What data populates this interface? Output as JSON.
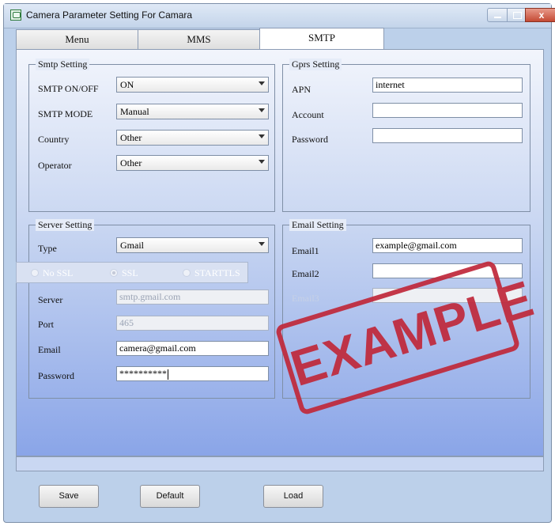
{
  "window": {
    "title": "Camera Parameter Setting For  Camara",
    "close_label": "x"
  },
  "tabs": [
    {
      "label": "Menu"
    },
    {
      "label": "MMS"
    },
    {
      "label": "SMTP"
    }
  ],
  "smtp_setting": {
    "title": "Smtp Setting",
    "rows": [
      {
        "label": "SMTP ON/OFF",
        "value": "ON"
      },
      {
        "label": "SMTP MODE",
        "value": "Manual"
      },
      {
        "label": "Country",
        "value": "Other"
      },
      {
        "label": "Operator",
        "value": "Other"
      }
    ]
  },
  "gprs_setting": {
    "title": "Gprs Setting",
    "rows": [
      {
        "label": "APN",
        "value": "internet"
      },
      {
        "label": "Account",
        "value": ""
      },
      {
        "label": "Password",
        "value": ""
      }
    ]
  },
  "server_setting": {
    "title": "Server Setting",
    "type_label": "Type",
    "type_value": "Gmail",
    "ssl_options": [
      "No SSL",
      "SSL",
      "STARTTLS"
    ],
    "ssl_selected": "SSL",
    "server_label": "Server",
    "server_value": "smtp.gmail.com",
    "port_label": "Port",
    "port_value": "465",
    "email_label": "Email",
    "email_value": "camera@gmail.com",
    "password_label": "Password",
    "password_value": "**********"
  },
  "email_setting": {
    "title": "Email Setting",
    "rows": [
      {
        "label": "Email1",
        "value": "example@gmail.com"
      },
      {
        "label": "Email2",
        "value": ""
      },
      {
        "label": "Email3",
        "value": ""
      }
    ]
  },
  "watermark": {
    "text": "EXAMPLE",
    "color": "#c0283a"
  },
  "buttons": {
    "save": "Save",
    "default": "Default",
    "load": "Load"
  }
}
